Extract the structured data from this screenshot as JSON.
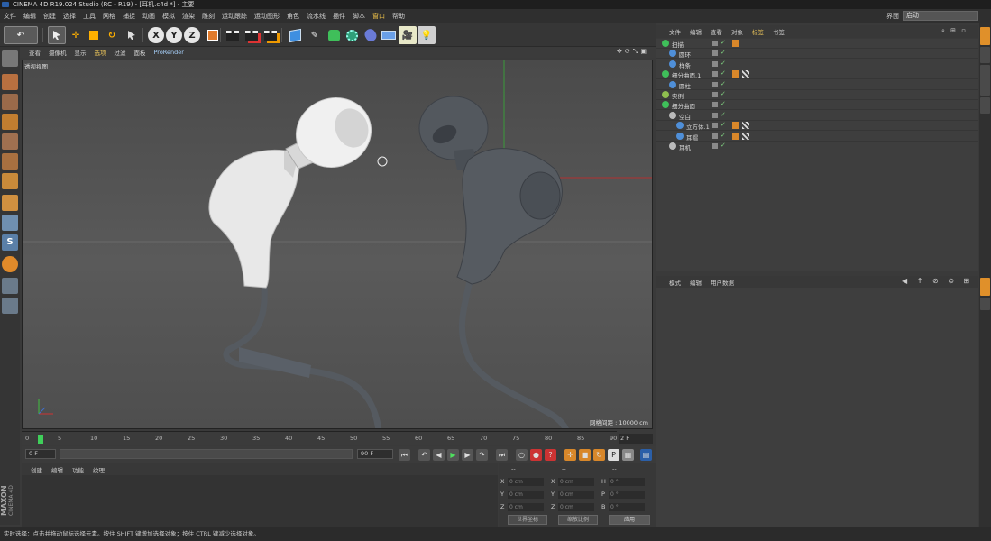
{
  "window": {
    "title": "CINEMA 4D R19.024 Studio (RC - R19) - [耳机.c4d *] - 主要"
  },
  "menu": [
    "文件",
    "编辑",
    "创建",
    "选择",
    "工具",
    "网格",
    "捕捉",
    "动画",
    "模拟",
    "渲染",
    "雕刻",
    "运动跟踪",
    "运动图形",
    "角色",
    "流水线",
    "插件",
    "脚本",
    "窗口",
    "帮助"
  ],
  "layout": {
    "label": "界面",
    "value": "启动"
  },
  "viewport": {
    "menu": [
      "查看",
      "摄像机",
      "显示",
      "选项",
      "过滤",
      "面板",
      "ProRender"
    ],
    "name": "透视视图",
    "grid_info": "网格间距 : 10000 cm"
  },
  "timeline": {
    "ticks": [
      "0",
      "5",
      "10",
      "15",
      "20",
      "25",
      "30",
      "35",
      "40",
      "45",
      "50",
      "55",
      "60",
      "65",
      "70",
      "75",
      "80",
      "85",
      "90"
    ],
    "current_frame": "2 F",
    "start": "0 F",
    "end": "90 F",
    "range_end": "90 F"
  },
  "materials": {
    "menu": [
      "创建",
      "编辑",
      "功能",
      "纹理"
    ]
  },
  "coordinates": {
    "header": [
      "--",
      "--",
      "--"
    ],
    "labels": [
      "X",
      "Y",
      "Z",
      "X",
      "Y",
      "Z",
      "H",
      "P",
      "B"
    ],
    "values": [
      "0 cm",
      "0 cm",
      "0 cm",
      "0 cm",
      "0 cm",
      "0 cm",
      "0 °",
      "0 °",
      "0 °"
    ],
    "mode1": "世界坐标",
    "mode2": "缩放比例",
    "apply": "应用"
  },
  "object_manager": {
    "menu": [
      "文件",
      "编辑",
      "查看",
      "对象",
      "标签",
      "书签"
    ],
    "objects": [
      {
        "name": "扫描",
        "indent": 0
      },
      {
        "name": "圆环",
        "indent": 1
      },
      {
        "name": "样条",
        "indent": 1
      },
      {
        "name": "细分曲面.1",
        "indent": 0
      },
      {
        "name": "圆柱",
        "indent": 1
      },
      {
        "name": "实例",
        "indent": 0
      },
      {
        "name": "细分曲面",
        "indent": 0
      },
      {
        "name": "空白",
        "indent": 1
      },
      {
        "name": "立方体.1",
        "indent": 2
      },
      {
        "name": "耳帽",
        "indent": 2
      },
      {
        "name": "耳机",
        "indent": 1
      }
    ]
  },
  "attributes": {
    "menu": [
      "模式",
      "编辑",
      "用户数据"
    ]
  },
  "status": {
    "text": "实时选择：点击并拖动鼠标选择元素。按住 SHIFT 键增加选择对象；按住 CTRL 键减少选择对象。"
  },
  "branding": {
    "maxon": "MAXON",
    "product": "CINEMA 4D"
  },
  "colors": {
    "accent": "#e0902a",
    "active_menu": "#e8c25a",
    "viewport_bg": "#555555"
  }
}
